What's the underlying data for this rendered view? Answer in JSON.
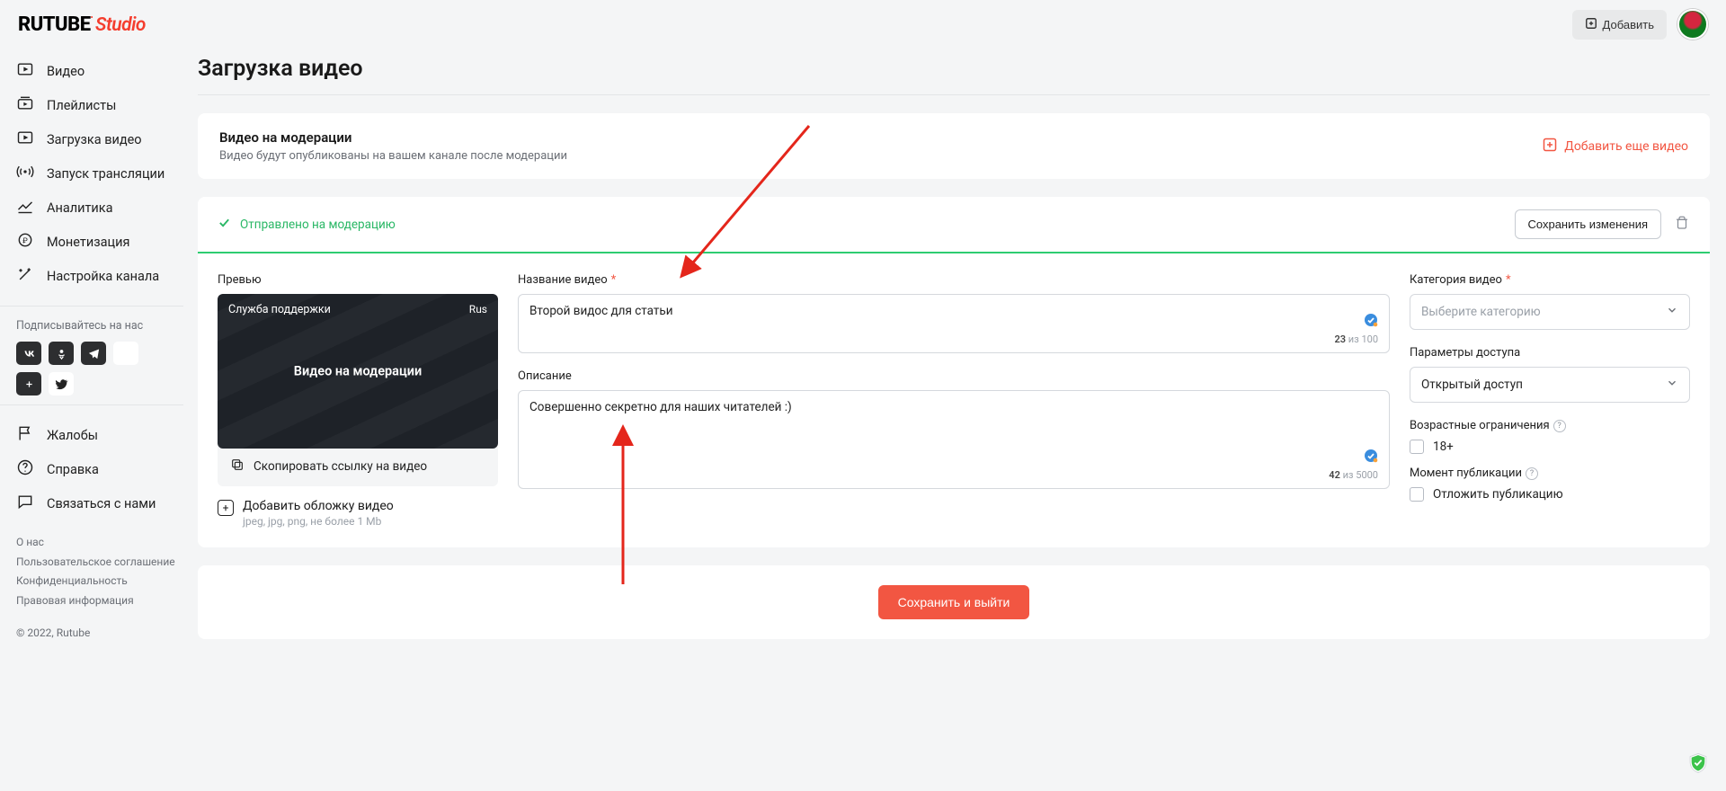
{
  "logo": {
    "main": "RUTUBE",
    "sub": "Studio"
  },
  "header": {
    "add_button": "Добавить"
  },
  "sidebar": {
    "items": [
      {
        "label": "Видео"
      },
      {
        "label": "Плейлисты"
      },
      {
        "label": "Загрузка видео"
      },
      {
        "label": "Запуск трансляции"
      },
      {
        "label": "Аналитика"
      },
      {
        "label": "Монетизация"
      },
      {
        "label": "Настройка канала"
      }
    ],
    "subscribe_label": "Подписывайтесь на нас",
    "lower_items": [
      {
        "label": "Жалобы"
      },
      {
        "label": "Справка"
      },
      {
        "label": "Связаться с нами"
      }
    ],
    "footer": {
      "links": [
        "О нас",
        "Пользовательское соглашение",
        "Конфиденциальность",
        "Правовая информация"
      ],
      "copyright": "© 2022, Rutube"
    }
  },
  "page": {
    "title": "Загрузка видео",
    "moderation_banner": {
      "title": "Видео на модерации",
      "subtitle": "Видео будут опубликованы на вашем канале после модерации",
      "add_more": "Добавить еще видео"
    },
    "editor": {
      "status": "Отправлено на модерацию",
      "save_changes": "Сохранить изменения",
      "preview": {
        "label": "Превью",
        "badge_left": "Служба поддержки",
        "badge_right": "Rus",
        "overlay": "Видео на модерации",
        "copy_link": "Скопировать ссылку на видео",
        "add_cover": "Добавить обложку видео",
        "cover_hint": "jpeg, jpg, png, не более 1 Mb"
      },
      "title_field": {
        "label": "Название видео",
        "value": "Второй видос для статьи",
        "count": "23",
        "max": "100"
      },
      "desc_field": {
        "label": "Описание",
        "value": "Совершенно секретно для наших читателей :)",
        "count": "42",
        "max": "5000"
      },
      "category": {
        "label": "Категория видео",
        "placeholder": "Выберите категорию"
      },
      "access": {
        "label": "Параметры доступа",
        "value": "Открытый доступ"
      },
      "age": {
        "label": "Возрастные ограничения",
        "option": "18+"
      },
      "publish_moment": {
        "label": "Момент публикации",
        "option": "Отложить публикацию"
      }
    },
    "save_exit": "Сохранить и выйти"
  },
  "counter_sep": " из "
}
